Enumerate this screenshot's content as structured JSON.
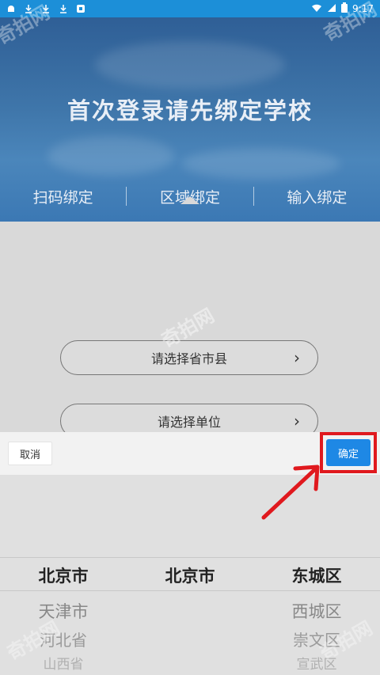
{
  "status_bar": {
    "time": "9:17",
    "icons_left": [
      "android-icon",
      "download-icon",
      "download-icon",
      "download-icon",
      "notification-icon"
    ],
    "icons_right": [
      "wifi-icon",
      "signal-icon",
      "battery-icon"
    ]
  },
  "hero": {
    "title": "首次登录请先绑定学校"
  },
  "tabs": [
    {
      "label": "扫码绑定"
    },
    {
      "label": "区域绑定"
    },
    {
      "label": "输入绑定"
    }
  ],
  "form": {
    "region_selector": "请选择省市县",
    "unit_selector": "请选择单位"
  },
  "sheet": {
    "cancel_label": "取消",
    "confirm_label": "确定"
  },
  "picker": {
    "provinces": [
      "北京市",
      "天津市",
      "河北省",
      "山西省"
    ],
    "cities": [
      "北京市"
    ],
    "districts": [
      "东城区",
      "西城区",
      "崇文区",
      "宣武区"
    ]
  },
  "watermark": "奇拍网",
  "colors": {
    "status_bar": "#1c8fd8",
    "confirm": "#1e88e5",
    "highlight": "#e0191e"
  }
}
